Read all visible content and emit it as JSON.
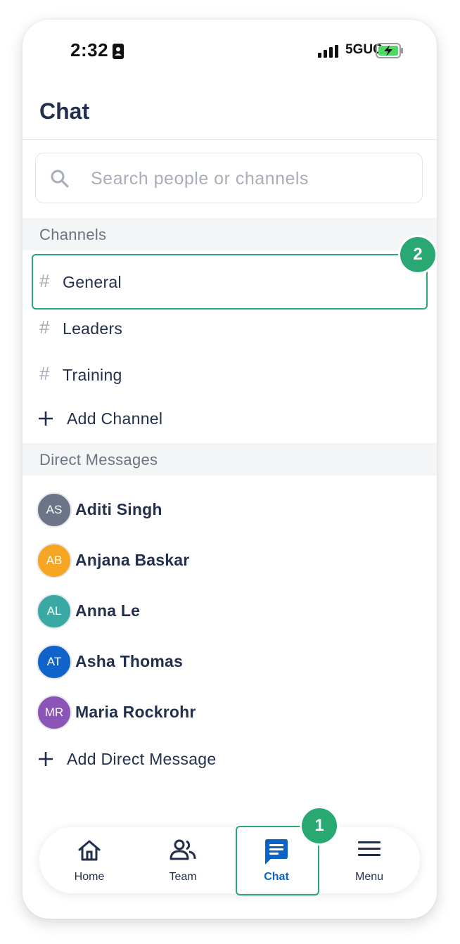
{
  "status_bar": {
    "time": "2:32",
    "network": "5GUC"
  },
  "header": {
    "title": "Chat"
  },
  "search": {
    "placeholder": "Search people or channels",
    "value": ""
  },
  "channels": {
    "section_title": "Channels",
    "items": [
      {
        "hash": "#",
        "label": "General"
      },
      {
        "hash": "#",
        "label": "Leaders"
      },
      {
        "hash": "#",
        "label": "Training"
      }
    ],
    "add_label": "Add Channel"
  },
  "direct_messages": {
    "section_title": "Direct Messages",
    "items": [
      {
        "initials": "AS",
        "name": "Aditi Singh",
        "color": "#6b7587"
      },
      {
        "initials": "AB",
        "name": "Anjana Baskar",
        "color": "#f5a623"
      },
      {
        "initials": "AL",
        "name": "Anna Le",
        "color": "#3aa9a4"
      },
      {
        "initials": "AT",
        "name": "Asha Thomas",
        "color": "#0f63c9"
      },
      {
        "initials": "MR",
        "name": "Maria Rockrohr",
        "color": "#8b55b8"
      }
    ],
    "add_label": "Add Direct Message"
  },
  "tabs": [
    {
      "label": "Home",
      "icon": "home-icon"
    },
    {
      "label": "Team",
      "icon": "team-icon"
    },
    {
      "label": "Chat",
      "icon": "chat-icon",
      "active": true
    },
    {
      "label": "Menu",
      "icon": "menu-icon"
    }
  ],
  "annotations": {
    "step_1": "1",
    "step_2": "2"
  },
  "colors": {
    "accent": "#0b63c5",
    "highlight": "#2aa873",
    "text": "#23304d"
  }
}
